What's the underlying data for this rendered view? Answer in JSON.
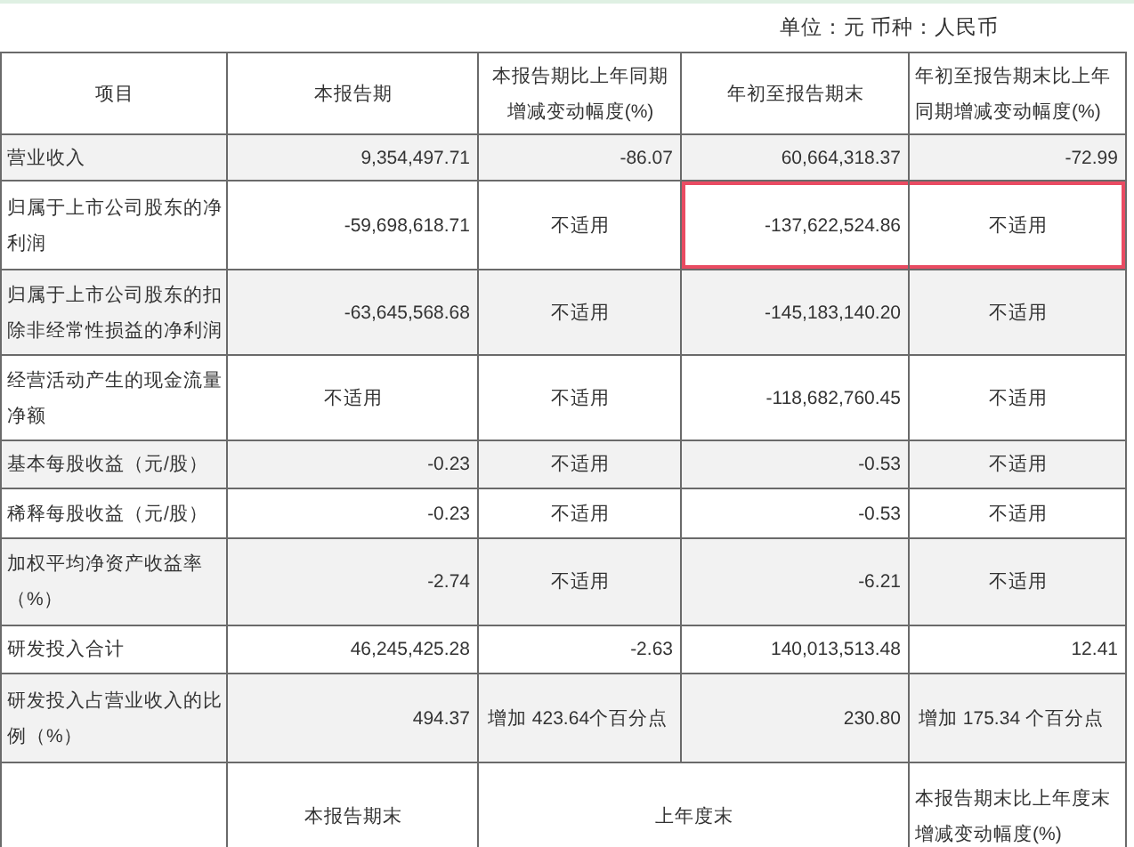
{
  "unit_label": "单位：元 币种：人民币",
  "header": [
    "项目",
    "本报告期",
    "本报告期比上年同期增减变动幅度(%)",
    "年初至报告期末",
    "年初至报告期末比上年同期增减变动幅度(%)"
  ],
  "rows": [
    {
      "cells": [
        {
          "kind": "label",
          "text": "营业收入",
          "highlighted": false
        },
        {
          "kind": "number",
          "text": "9,354,497.71",
          "highlighted": false
        },
        {
          "kind": "number",
          "text": "-86.07",
          "highlighted": false
        },
        {
          "kind": "number",
          "text": "60,664,318.37",
          "highlighted": false
        },
        {
          "kind": "number",
          "text": "-72.99",
          "highlighted": false
        }
      ]
    },
    {
      "cells": [
        {
          "kind": "label",
          "text": "归属于上市公司股东的净利润",
          "highlighted": false
        },
        {
          "kind": "number",
          "text": "-59,698,618.71",
          "highlighted": false
        },
        {
          "kind": "center",
          "text": "不适用",
          "highlighted": false
        },
        {
          "kind": "number",
          "text": "-137,622,524.86",
          "highlighted": true
        },
        {
          "kind": "center",
          "text": "不适用",
          "highlighted": true
        }
      ]
    },
    {
      "cells": [
        {
          "kind": "label",
          "text": "归属于上市公司股东的扣除非经常性损益的净利润",
          "highlighted": false
        },
        {
          "kind": "number",
          "text": "-63,645,568.68",
          "highlighted": false
        },
        {
          "kind": "center",
          "text": "不适用",
          "highlighted": false
        },
        {
          "kind": "number",
          "text": "-145,183,140.20",
          "highlighted": false
        },
        {
          "kind": "center",
          "text": "不适用",
          "highlighted": false
        }
      ]
    },
    {
      "cells": [
        {
          "kind": "label",
          "text": "经营活动产生的现金流量净额",
          "highlighted": false
        },
        {
          "kind": "center",
          "text": "不适用",
          "highlighted": false
        },
        {
          "kind": "center",
          "text": "不适用",
          "highlighted": false
        },
        {
          "kind": "number",
          "text": "-118,682,760.45",
          "highlighted": false
        },
        {
          "kind": "center",
          "text": "不适用",
          "highlighted": false
        }
      ]
    },
    {
      "cells": [
        {
          "kind": "label",
          "text": "基本每股收益（元/股）",
          "highlighted": false
        },
        {
          "kind": "number",
          "text": "-0.23",
          "highlighted": false
        },
        {
          "kind": "center",
          "text": "不适用",
          "highlighted": false
        },
        {
          "kind": "number",
          "text": "-0.53",
          "highlighted": false
        },
        {
          "kind": "center",
          "text": "不适用",
          "highlighted": false
        }
      ]
    },
    {
      "cells": [
        {
          "kind": "label",
          "text": "稀释每股收益（元/股）",
          "highlighted": false
        },
        {
          "kind": "number",
          "text": "-0.23",
          "highlighted": false
        },
        {
          "kind": "center",
          "text": "不适用",
          "highlighted": false
        },
        {
          "kind": "number",
          "text": "-0.53",
          "highlighted": false
        },
        {
          "kind": "center",
          "text": "不适用",
          "highlighted": false
        }
      ]
    },
    {
      "cells": [
        {
          "kind": "label",
          "text": "加权平均净资产收益率（%）",
          "highlighted": false
        },
        {
          "kind": "number",
          "text": "-2.74",
          "highlighted": false
        },
        {
          "kind": "center",
          "text": "不适用",
          "highlighted": false
        },
        {
          "kind": "number",
          "text": "-6.21",
          "highlighted": false
        },
        {
          "kind": "center",
          "text": "不适用",
          "highlighted": false
        }
      ]
    },
    {
      "cells": [
        {
          "kind": "label",
          "text": "研发投入合计",
          "highlighted": false
        },
        {
          "kind": "number",
          "text": "46,245,425.28",
          "highlighted": false
        },
        {
          "kind": "number",
          "text": "-2.63",
          "highlighted": false
        },
        {
          "kind": "number",
          "text": "140,013,513.48",
          "highlighted": false
        },
        {
          "kind": "number",
          "text": "12.41",
          "highlighted": false
        }
      ]
    },
    {
      "cells": [
        {
          "kind": "label",
          "text": "研发投入占营业收入的比例（%）",
          "highlighted": false
        },
        {
          "kind": "number",
          "text": "494.37",
          "highlighted": false
        },
        {
          "kind": "note",
          "text": "增加 423.64个百分点",
          "highlighted": false
        },
        {
          "kind": "number",
          "text": "230.80",
          "highlighted": false
        },
        {
          "kind": "note",
          "text": "增加 175.34 个百分点",
          "highlighted": false
        }
      ]
    },
    {
      "cells": [
        {
          "kind": "blank",
          "highlighted": false
        },
        {
          "kind": "center",
          "text": "本报告期末",
          "highlighted": false
        },
        {
          "kind": "wide",
          "text": "上年度末",
          "highlighted": false
        },
        {
          "kind": "label",
          "text": "本报告期末比上年度末增减变动幅度(%)",
          "highlighted": false
        }
      ]
    }
  ]
}
